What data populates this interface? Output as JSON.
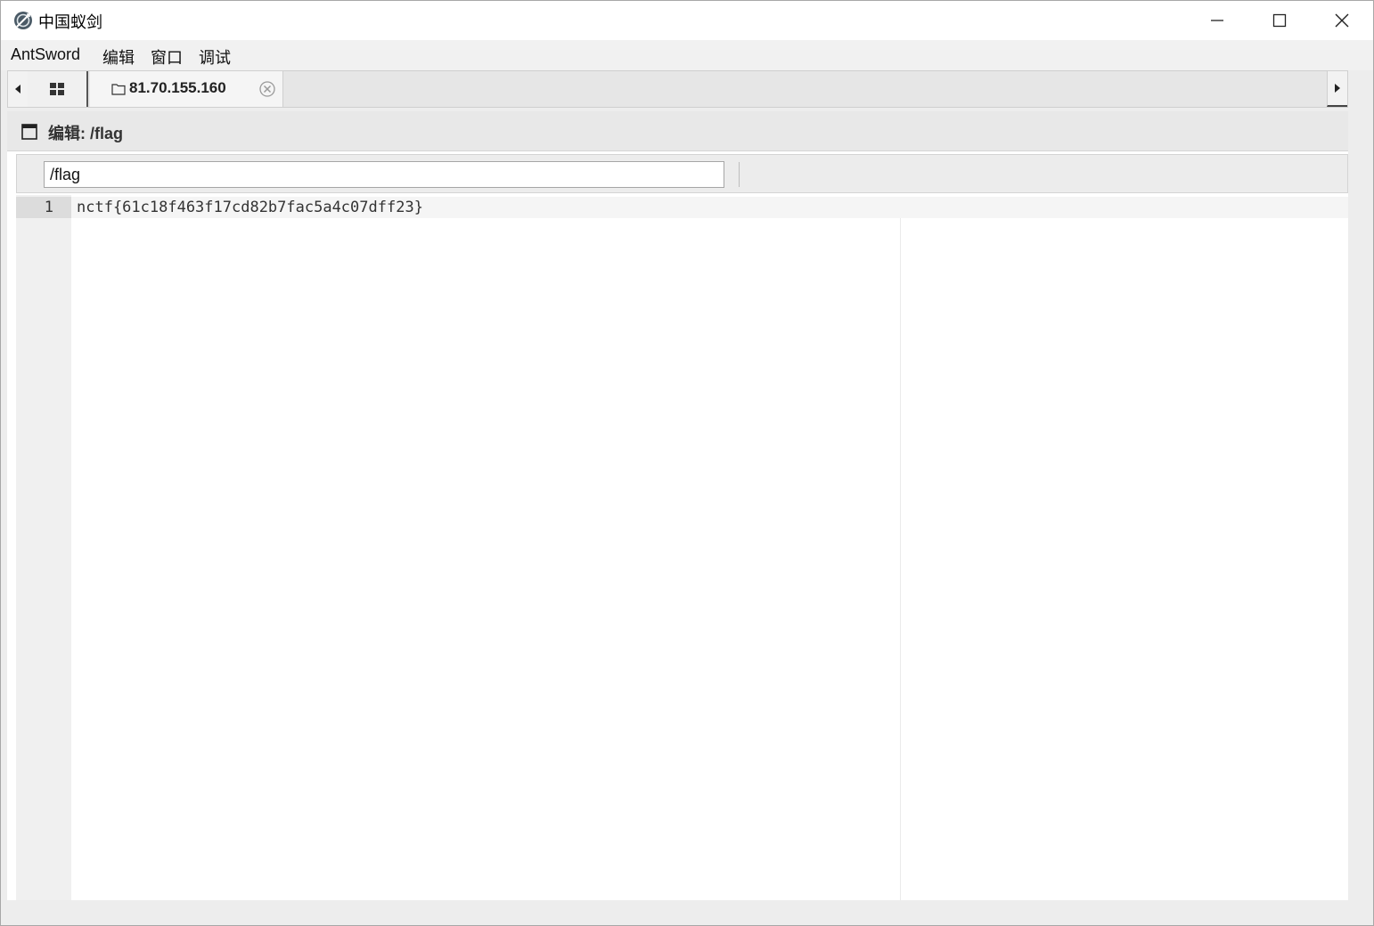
{
  "window": {
    "title": "中国蚁剑"
  },
  "menu": {
    "items": [
      "AntSword",
      "编辑",
      "窗口",
      "调试"
    ]
  },
  "tabs": {
    "active_label": "81.70.155.160"
  },
  "panel": {
    "title": "编辑: /flag"
  },
  "toolbar": {
    "path_value": "/flag"
  },
  "editor": {
    "lines": [
      {
        "number": "1",
        "text": "nctf{61c18f463f17cd82b7fac5a4c07dff23}"
      }
    ]
  }
}
